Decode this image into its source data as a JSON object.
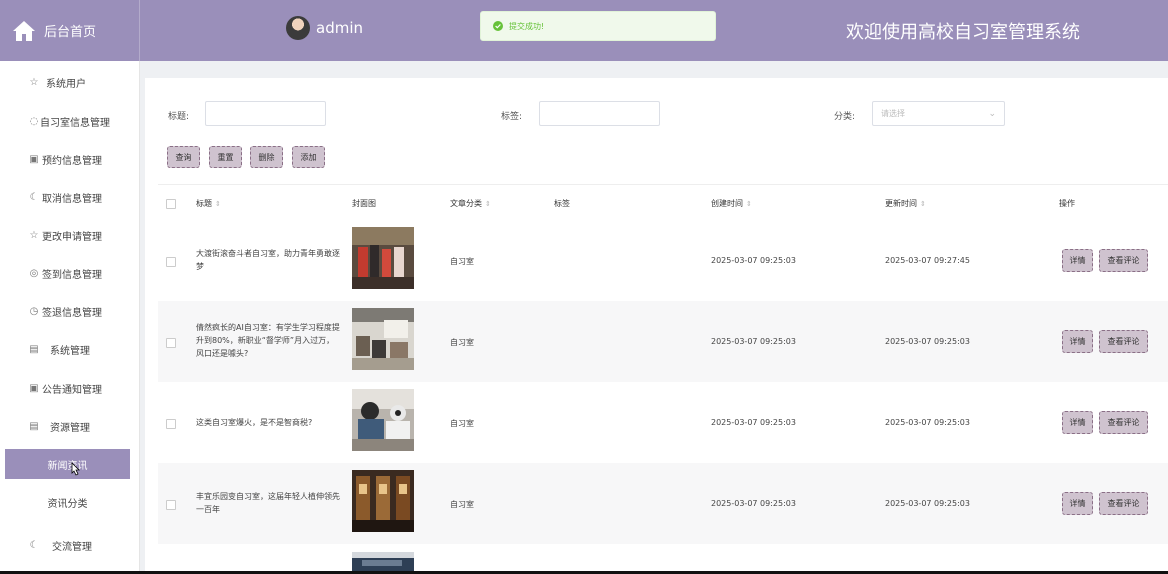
{
  "header": {
    "home_label": "后台首页",
    "user_name": "admin",
    "toast": "提交成功!",
    "welcome": "欢迎使用高校自习室管理系统",
    "bg_color": "#9a8fba"
  },
  "sidebar": {
    "items": [
      {
        "label": "系统用户",
        "icon": "star-outline-icon"
      },
      {
        "label": "自习室信息管理",
        "icon": "drop-icon"
      },
      {
        "label": "预约信息管理",
        "icon": "basket-icon"
      },
      {
        "label": "取消信息管理",
        "icon": "moon-icon"
      },
      {
        "label": "更改申请管理",
        "icon": "star-outline-icon"
      },
      {
        "label": "签到信息管理",
        "icon": "compass-icon"
      },
      {
        "label": "签退信息管理",
        "icon": "timer-icon"
      },
      {
        "label": "系统管理",
        "icon": "calendar-icon"
      },
      {
        "label": "公告通知管理",
        "icon": "basket-icon"
      },
      {
        "label": "资源管理",
        "icon": "calendar-icon"
      }
    ],
    "sub_items": [
      {
        "label": "新闻资讯",
        "active": true
      },
      {
        "label": "资讯分类",
        "active": false
      }
    ],
    "last_item": {
      "label": "交流管理",
      "icon": "moon-icon"
    }
  },
  "search": {
    "title_label": "标题:",
    "tag_label": "标签:",
    "category_label": "分类:",
    "category_placeholder": "请选择"
  },
  "buttons": {
    "query": "查询",
    "reset": "重置",
    "delete": "删除",
    "add": "添加"
  },
  "table": {
    "headers": {
      "title": "标题",
      "cover": "封面图",
      "category": "文章分类",
      "tag": "标签",
      "created": "创建时间",
      "updated": "更新时间",
      "actions": "操作"
    },
    "rows": [
      {
        "title": "大渡街滚奋斗者自习室，助力青年勇敢逐梦",
        "category": "自习室",
        "created": "2025-03-07 09:25:03",
        "updated": "2025-03-07 09:27:45"
      },
      {
        "title": "倩然疯长的AI自习室：有学生学习程度提升到80%，新职业“督学师”月入过万，风口还是噱头?",
        "category": "自习室",
        "created": "2025-03-07 09:25:03",
        "updated": "2025-03-07 09:25:03"
      },
      {
        "title": "这类自习室爆火，是不是智商税?",
        "category": "自习室",
        "created": "2025-03-07 09:25:03",
        "updated": "2025-03-07 09:25:03"
      },
      {
        "title": "丰宜乐园变自习室，这届年轻人植伸领先一百年",
        "category": "自习室",
        "created": "2025-03-07 09:25:03",
        "updated": "2025-03-07 09:25:03"
      }
    ],
    "detail_label": "详情",
    "comments_label": "查看评论"
  }
}
